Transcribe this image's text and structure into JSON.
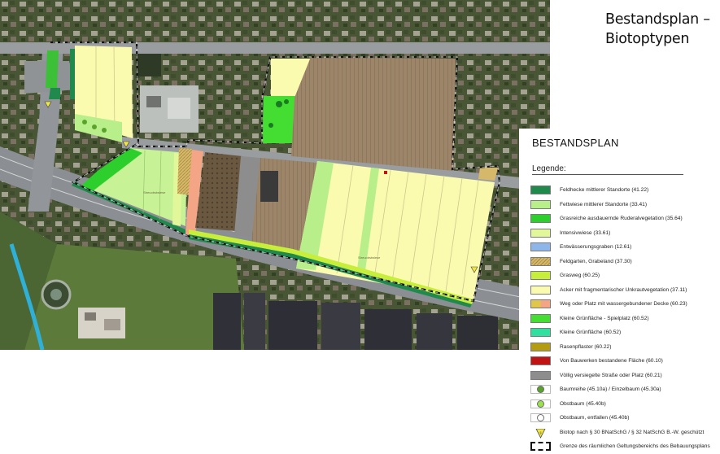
{
  "title": {
    "line1": "Bestandsplan –",
    "line2": "Biotoptypen"
  },
  "legend": {
    "heading": "BESTANDSPLAN",
    "subheading": "Legende:",
    "items": [
      {
        "label": "Feldhecke mittlerer Standorte (41.22)",
        "color": "#1f8a4b",
        "symbol": "fill"
      },
      {
        "label": "Fettwiese mittlerer Standorte (33.41)",
        "color": "#b8ef8a",
        "symbol": "fill"
      },
      {
        "label": "Grasreiche ausdauernde Ruderalvegetation (35.64)",
        "color": "#2ccf2c",
        "symbol": "fill"
      },
      {
        "label": "Intensivwiese (33.61)",
        "color": "#e2f79a",
        "symbol": "fill"
      },
      {
        "label": "Entwässerungsgraben (12.61)",
        "color": "#8fb6ea",
        "symbol": "fill"
      },
      {
        "label": "Feldgarten, Grabeland (37.30)",
        "color": "#d6b86a",
        "symbol": "hatch"
      },
      {
        "label": "Grasweg (60.25)",
        "color": "#c6ee3a",
        "symbol": "fill"
      },
      {
        "label": "Acker mit fragmentarischer Unkrautvegetation (37.11)",
        "color": "#fbfbb0",
        "symbol": "fill"
      },
      {
        "label": "Weg oder Platz mit wassergebundener Decke (60.23)",
        "color": "#f4a585",
        "symbol": "split"
      },
      {
        "label": "Kleine Grünfläche - Spielplatz (60.52)",
        "color": "#44dd32",
        "symbol": "fill"
      },
      {
        "label": "Kleine Grünfläche (60.52)",
        "color": "#2fe0a0",
        "symbol": "fill"
      },
      {
        "label": "Rasenpflaster (60.22)",
        "color": "#b39c12",
        "symbol": "fill"
      },
      {
        "label": "Von Bauwerken bestandene Fläche (60.10)",
        "color": "#c01414",
        "symbol": "fill"
      },
      {
        "label": "Völlig versiegelte Straße oder Platz (60.21)",
        "color": "#8d8d8d",
        "symbol": "fill"
      },
      {
        "label": "Baumreihe (45.10a) / Einzelbaum (45.30a)",
        "color": "#5aa32a",
        "symbol": "tree"
      },
      {
        "label": "Obstbaum (45.40b)",
        "color": "#9be34a",
        "symbol": "tree"
      },
      {
        "label": "Obstbaum, entfallen (45.40b)",
        "color": "#ffffff",
        "symbol": "tree-empty"
      },
      {
        "label": "Biotop nach § 30 BNatSchG / § 32 NatSchG B.-W. geschützt",
        "color": "#f2e640",
        "symbol": "triangle"
      },
      {
        "label": "Grenze des räumlichen Geltungsbereichs des Bebauungsplans",
        "color": "#111111",
        "symbol": "dashed"
      }
    ]
  },
  "map": {
    "field_labels": [
      "Streuobstwiese",
      "Streuobstwiese"
    ]
  }
}
